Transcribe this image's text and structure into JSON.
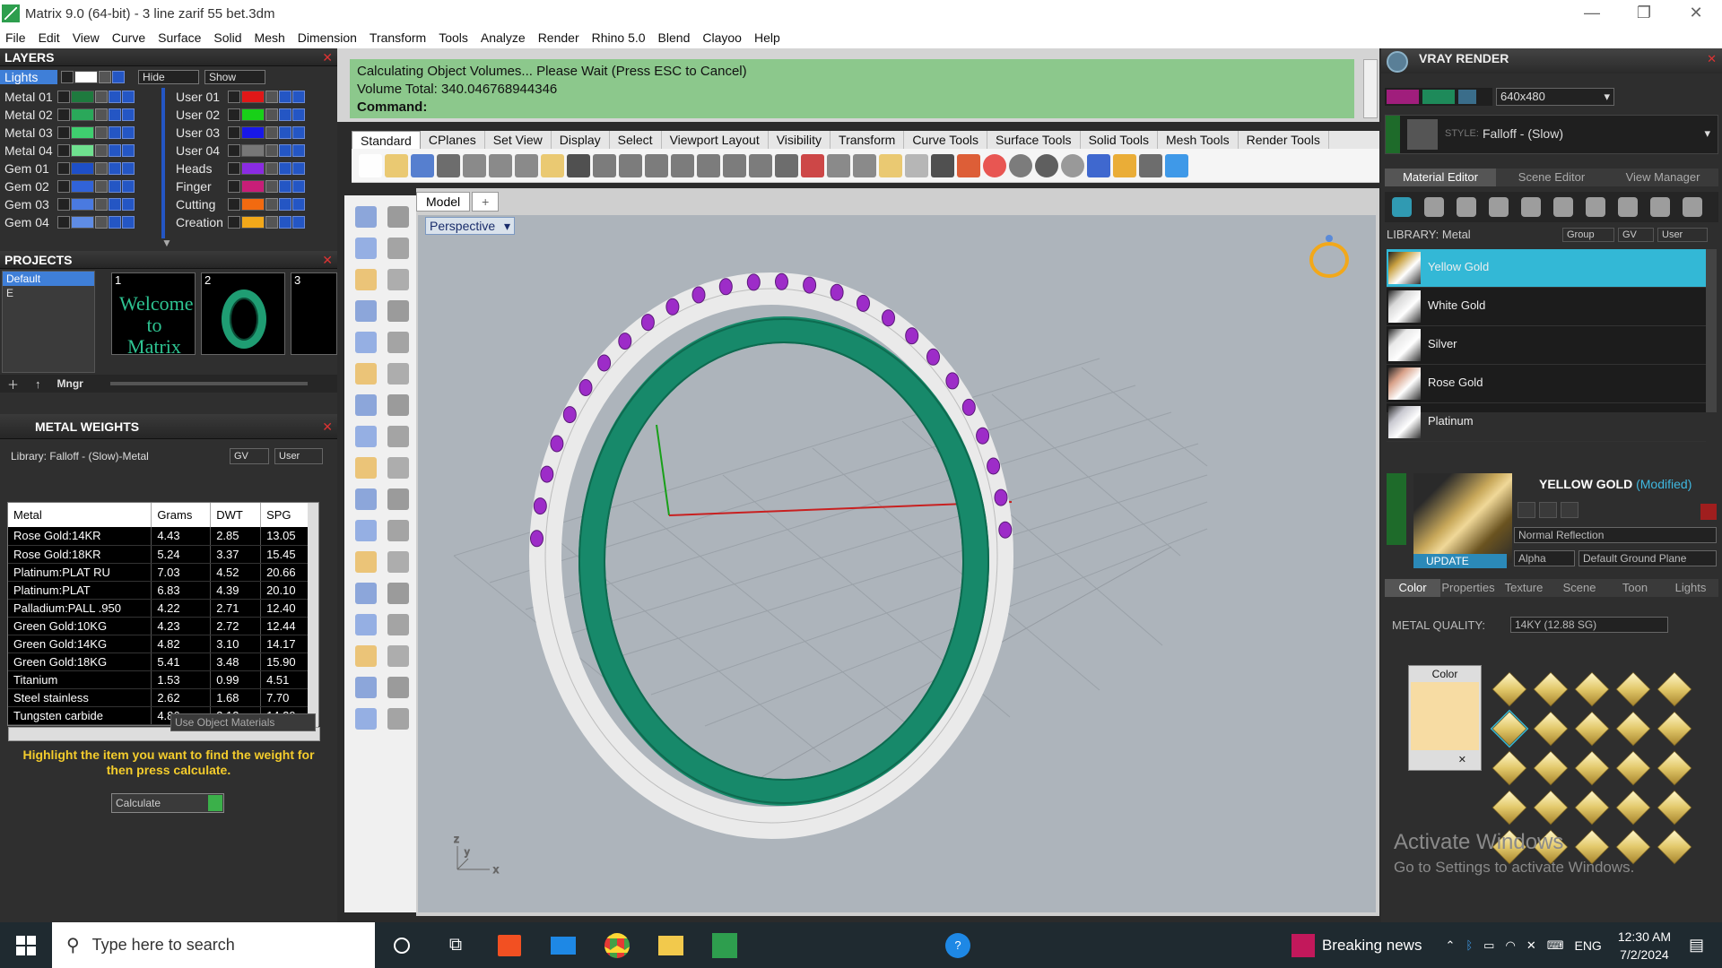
{
  "window": {
    "title": "Matrix 9.0 (64-bit) - 3 line zarif 55 bet.3dm",
    "minimize": "—",
    "maximize": "❐",
    "close": "✕"
  },
  "menu": [
    "File",
    "Edit",
    "View",
    "Curve",
    "Surface",
    "Solid",
    "Mesh",
    "Dimension",
    "Transform",
    "Tools",
    "Analyze",
    "Render",
    "Rhino 5.0",
    "Blend",
    "Clayoo",
    "Help"
  ],
  "layers": {
    "title": "LAYERS",
    "lights": "Lights",
    "hide": "Hide",
    "show": "Show",
    "left_rows": [
      {
        "name": "Metal 01",
        "color": "#1e7a3e"
      },
      {
        "name": "Metal 02",
        "color": "#2aa85a"
      },
      {
        "name": "Metal 03",
        "color": "#3fcf6f"
      },
      {
        "name": "Metal 04",
        "color": "#6fe08f"
      },
      {
        "name": "Gem 01",
        "color": "#1e4fc8"
      },
      {
        "name": "Gem 02",
        "color": "#3163d8"
      },
      {
        "name": "Gem 03",
        "color": "#4a7ae0"
      },
      {
        "name": "Gem 04",
        "color": "#5f8ce4"
      }
    ],
    "right_rows": [
      {
        "name": "User 01",
        "color": "#e01818"
      },
      {
        "name": "User 02",
        "color": "#18d018"
      },
      {
        "name": "User 03",
        "color": "#1818e8"
      },
      {
        "name": "User 04",
        "color": "#777777"
      },
      {
        "name": "Heads",
        "color": "#8a2be2"
      },
      {
        "name": "Finger",
        "color": "#c81e78"
      },
      {
        "name": "Cutting",
        "color": "#f26a10"
      },
      {
        "name": "Creation",
        "color": "#f2a81a"
      }
    ]
  },
  "projects": {
    "title": "PROJECTS",
    "list": [
      "Default",
      "E"
    ],
    "thumbs": [
      {
        "num": "1",
        "text": "Welcome to Matrix"
      },
      {
        "num": "2",
        "text": ""
      },
      {
        "num": "3",
        "text": ""
      }
    ],
    "mngr": "Mngr"
  },
  "metal_weights": {
    "title": "METAL WEIGHTS",
    "library": "Library: Falloff - (Slow)-Metal",
    "gv": "GV",
    "user": "User",
    "columns": [
      "Metal",
      "Grams",
      "DWT",
      "SPG"
    ],
    "rows": [
      [
        "Rose Gold:14KR",
        "4.43",
        "2.85",
        "13.05"
      ],
      [
        "Rose Gold:18KR",
        "5.24",
        "3.37",
        "15.45"
      ],
      [
        "Platinum:PLAT RU",
        "7.03",
        "4.52",
        "20.66"
      ],
      [
        "Platinum:PLAT",
        "6.83",
        "4.39",
        "20.10"
      ],
      [
        "Palladium:PALL .950",
        "4.22",
        "2.71",
        "12.40"
      ],
      [
        "Green Gold:10KG",
        "4.23",
        "2.72",
        "12.44"
      ],
      [
        "Green Gold:14KG",
        "4.82",
        "3.10",
        "14.17"
      ],
      [
        "Green Gold:18KG",
        "5.41",
        "3.48",
        "15.90"
      ],
      [
        "Titanium",
        "1.53",
        "0.99",
        "4.51"
      ],
      [
        "Steel stainless",
        "2.62",
        "1.68",
        "7.70"
      ],
      [
        "Tungsten carbide",
        "4.86",
        "3.12",
        "14.29"
      ]
    ],
    "use_object_materials": "Use Object Materials",
    "highlight_message": "Highlight the item you want to find the weight for then press calculate.",
    "calculate": "Calculate"
  },
  "command": {
    "line1": "Calculating Object Volumes... Please Wait (Press ESC to Cancel)",
    "line2": "Volume Total: 340.046768944346",
    "prompt": "Command:"
  },
  "toolbar_tabs": [
    "Standard",
    "CPlanes",
    "Set View",
    "Display",
    "Select",
    "Viewport Layout",
    "Visibility",
    "Transform",
    "Curve Tools",
    "Surface Tools",
    "Solid Tools",
    "Mesh Tools",
    "Render Tools"
  ],
  "viewport": {
    "model_tab": "Model",
    "add_tab": "+",
    "label": "Perspective"
  },
  "vray": {
    "title": "VRAY RENDER",
    "resolution": "640x480",
    "style_label": "STYLE:",
    "style_value": "Falloff - (Slow)",
    "tabs": [
      "Material Editor",
      "Scene Editor",
      "View Manager"
    ],
    "library": "LIBRARY: Metal",
    "group": "Group",
    "gv": "GV",
    "user": "User",
    "materials": [
      {
        "name": "Yellow Gold",
        "selected": true,
        "color": "#c8a040"
      },
      {
        "name": "White Gold",
        "selected": false,
        "color": "#d8d8d8"
      },
      {
        "name": "Silver",
        "selected": false,
        "color": "#e8e8e8"
      },
      {
        "name": "Rose Gold",
        "selected": false,
        "color": "#d8a088"
      },
      {
        "name": "Platinum",
        "selected": false,
        "color": "#c8c8d0"
      }
    ],
    "selected_title": "YELLOW GOLD",
    "modified": "(Modified)",
    "reflection": "Normal Reflection",
    "update": "UPDATE",
    "alpha": "Alpha",
    "ground": "Default Ground Plane",
    "prop_tabs": [
      "Color",
      "Properties",
      "Texture",
      "Scene",
      "Toon",
      "Lights"
    ],
    "metal_quality_label": "METAL QUALITY:",
    "metal_quality_value": "14KY      (12.88 SG)",
    "color_label": "Color",
    "swatch_color": "#f7dca3"
  },
  "watermark": {
    "line1": "Activate Windows",
    "line2": "Go to Settings to activate Windows."
  },
  "taskbar": {
    "search_placeholder": "Type here to search",
    "news": "Breaking news",
    "lang": "ENG",
    "time": "12:30 AM",
    "date": "7/2/2024"
  }
}
